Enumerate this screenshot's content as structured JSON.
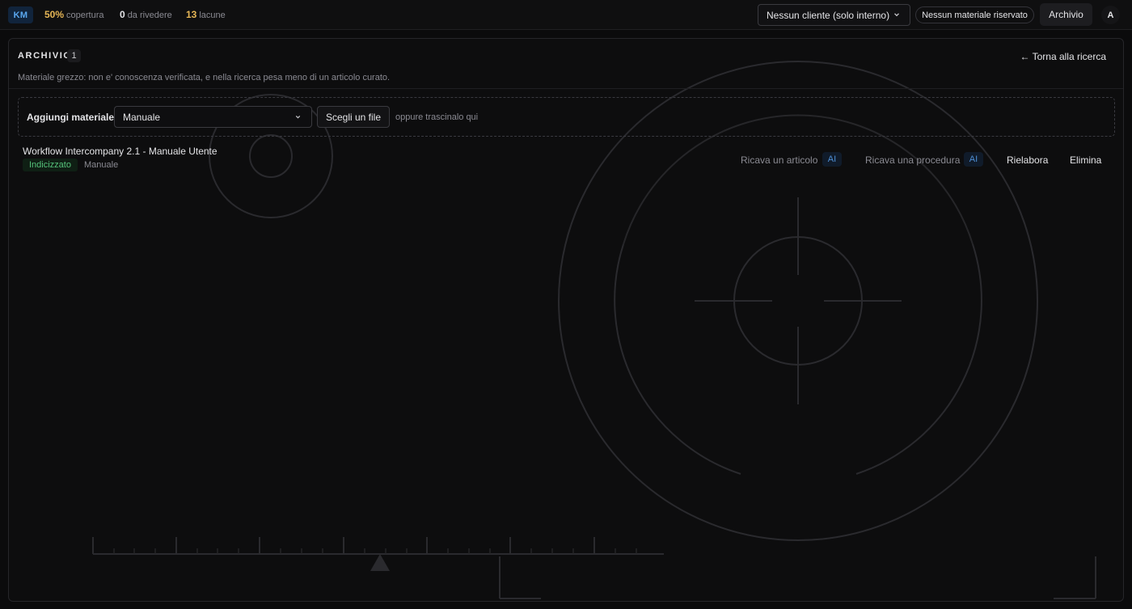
{
  "topbar": {
    "logo": "KM",
    "stats": [
      {
        "value": "50%",
        "label": "copertura"
      },
      {
        "value": "0",
        "label": "da rivedere"
      },
      {
        "value": "13",
        "label": "lacune"
      }
    ],
    "client_select": "Nessun cliente (solo interno)",
    "reserved_button": "Nessun materiale riservato",
    "archive_button": "Archivio",
    "avatar_initial": "A"
  },
  "panel": {
    "title": "ARCHIVIO",
    "count": "1",
    "back_link": "← Torna alla ricerca",
    "subtitle": "Materiale grezzo: non e' conoscenza verificata, e nella ricerca pesa meno di un articolo curato."
  },
  "upload": {
    "label": "Aggiungi materiale",
    "type_select": "Manuale",
    "file_button": "Scegli un file",
    "drop_hint": "oppure trascinalo qui"
  },
  "documents": [
    {
      "title": "Workflow Intercompany 2.1 - Manuale Utente",
      "status": "Indicizzato",
      "type": "Manuale",
      "actions": {
        "derive_article": "Ricava un articolo",
        "derive_article_tag": "AI",
        "derive_procedure": "Ricava una procedura",
        "derive_procedure_tag": "AI",
        "rework": "Rielabora",
        "delete": "Elimina"
      }
    }
  ],
  "colors": {
    "background": "#0b0b0c",
    "accent_blue": "#5aa8f0",
    "warning": "#e6b656",
    "success": "#55c27a",
    "muted": "#8a8a92"
  }
}
